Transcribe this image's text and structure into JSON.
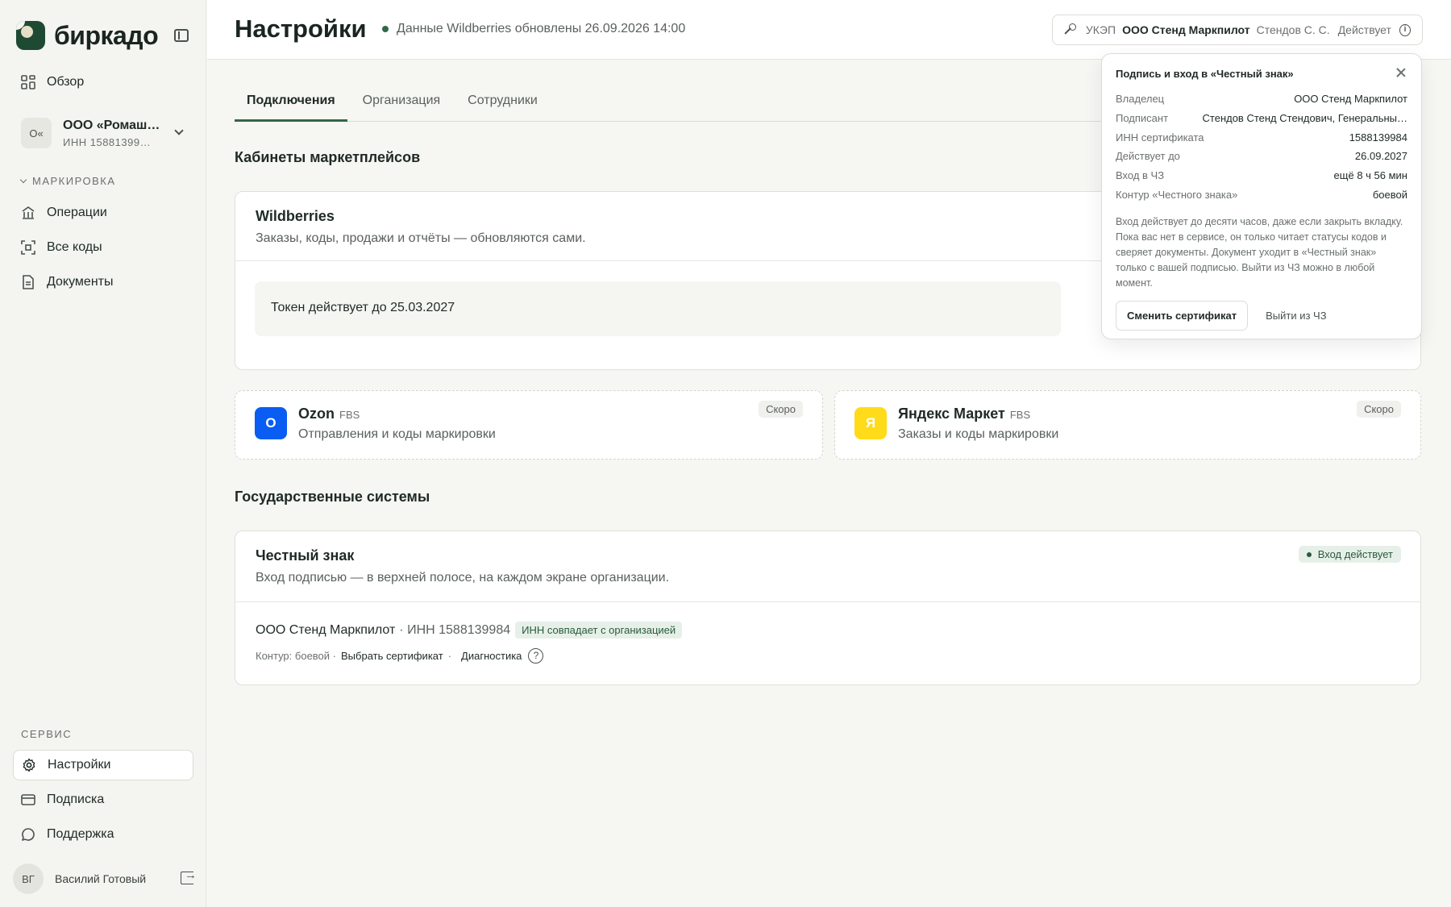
{
  "app": {
    "name": "биркадо"
  },
  "sidebar": {
    "overview": "Обзор",
    "org": {
      "avatar": "О«",
      "name": "ООО «Ромаш…",
      "inn": "ИНН 15881399…"
    },
    "marking_section": "МАРКИРОВКА",
    "marking_items": [
      "Операции",
      "Все коды",
      "Документы"
    ],
    "service_section": "СЕРВИС",
    "service_items": [
      "Настройки",
      "Подписка",
      "Поддержка"
    ],
    "user": {
      "initials": "ВГ",
      "name": "Василий Готовый"
    }
  },
  "header": {
    "title": "Настройки",
    "sync_status": "Данные Wildberries обновлены 26.09.2026 14:00",
    "cert": {
      "type": "УКЭП",
      "org": "ООО Стенд Маркпилот",
      "person": "Стендов С. С.",
      "status": "Действует"
    }
  },
  "tabs": [
    "Подключения",
    "Организация",
    "Сотрудники"
  ],
  "marketplaces": {
    "heading": "Кабинеты маркетплейсов",
    "wildberries": {
      "title": "Wildberries",
      "subtitle": "Заказы, коды, продажи и отчёты — обновляются сами.",
      "token": "Токен действует до 25.03.2027"
    },
    "ozon": {
      "logo": "O",
      "title": "Ozon",
      "tag": "FBS",
      "subtitle": "Отправления и коды маркировки",
      "badge": "Скоро"
    },
    "yandex": {
      "logo": "Я",
      "title": "Яндекс Маркет",
      "tag": "FBS",
      "subtitle": "Заказы и коды маркировки",
      "badge": "Скоро"
    }
  },
  "gov": {
    "heading": "Государственные системы",
    "chz": {
      "title": "Честный знак",
      "subtitle": "Вход подписью — в верхней полосе, на каждом экране организации.",
      "badge": "Вход действует",
      "org": "ООО Стенд Маркпилот",
      "inn": "· ИНН 1588139984",
      "match": "ИНН совпадает с организацией",
      "contour": "Контур: боевой ·",
      "select_cert": "Выбрать сертификат",
      "sep": "·",
      "diagnostics": "Диагностика",
      "help": "?"
    }
  },
  "popover": {
    "title": "Подпись и вход в «Честный знак»",
    "rows": [
      {
        "k": "Владелец",
        "v": "ООО Стенд Маркпилот"
      },
      {
        "k": "Подписант",
        "v": "Стендов Стенд Стендович, Генеральны…"
      },
      {
        "k": "ИНН сертификата",
        "v": "1588139984"
      },
      {
        "k": "Действует до",
        "v": "26.09.2027"
      },
      {
        "k": "Вход в ЧЗ",
        "v": "ещё 8 ч 56 мин"
      },
      {
        "k": "Контур «Честного знака»",
        "v": "боевой"
      }
    ],
    "description": "Вход действует до десяти часов, даже если закрыть вкладку. Пока вас нет в сервисе, он только читает статусы кодов и сверяет документы. Документ уходит в «Честный знак» только с вашей подписью. Выйти из ЧЗ можно в любой момент.",
    "change_cert": "Сменить сертификат",
    "logout": "Выйти из ЧЗ"
  },
  "colors": {
    "brand": "#1e4a34",
    "accent": "#2f6a46",
    "ozon": "#0a5df2",
    "yandex": "#ffdb1a"
  }
}
